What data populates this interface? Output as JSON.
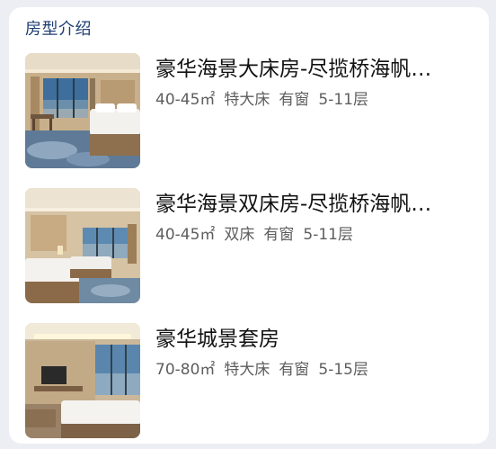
{
  "section": {
    "title": "房型介绍"
  },
  "rooms": [
    {
      "name": "豪华海景大床房-尽揽桥海帆…",
      "area": "40-45㎡",
      "bed": "特大床",
      "window": "有窗",
      "floors": "5-11层",
      "photo": "room-photo-king-sea-view"
    },
    {
      "name": "豪华海景双床房-尽揽桥海帆…",
      "area": "40-45㎡",
      "bed": "双床",
      "window": "有窗",
      "floors": "5-11层",
      "photo": "room-photo-twin-sea-view"
    },
    {
      "name": "豪华城景套房",
      "area": "70-80㎡",
      "bed": "特大床",
      "window": "有窗",
      "floors": "5-15层",
      "photo": "room-photo-city-view-suite"
    }
  ]
}
